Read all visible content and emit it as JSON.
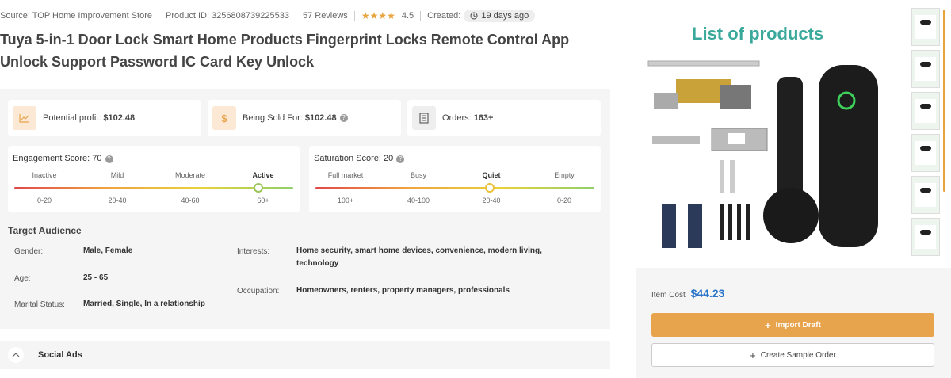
{
  "meta": {
    "source": "Source: TOP Home Improvement Store",
    "product_id": "Product ID: 3256808739225533",
    "reviews": "57 Reviews",
    "stars": "★★★★",
    "rating": "4.5",
    "created_label": "Created:",
    "created_value": "19 days ago"
  },
  "title": "Tuya 5-in-1 Door Lock Smart Home Products Fingerprint Locks Remote Control App Unlock Support Password IC Card Key Unlock",
  "stats": {
    "profit_label": "Potential profit:",
    "profit_value": "$102.48",
    "sold_label": "Being Sold For:",
    "sold_value": "$102.48",
    "orders_label": "Orders:",
    "orders_value": "163+"
  },
  "engagement": {
    "title": "Engagement Score: 70",
    "labels": [
      "Inactive",
      "Mild",
      "Moderate",
      "Active"
    ],
    "ranges": [
      "0-20",
      "20-40",
      "40-60",
      "60+"
    ],
    "level": 0.875
  },
  "saturation": {
    "title": "Saturation Score: 20",
    "labels": [
      "Full market",
      "Busy",
      "Quiet",
      "Empty"
    ],
    "ranges": [
      "100+",
      "40-100",
      "20-40",
      "0-20"
    ],
    "level": 0.625
  },
  "audience": {
    "title": "Target Audience",
    "gender_label": "Gender:",
    "gender": "Male, Female",
    "age_label": "Age:",
    "age": "25 - 65",
    "marital_label": "Marital Status:",
    "marital": "Married, Single, In a relationship",
    "interests_label": "Interests:",
    "interests": "Home security, smart home devices, convenience, modern living, technology",
    "occupation_label": "Occupation:",
    "occupation": "Homeowners, renters, property managers, professionals"
  },
  "social_ads": "Social Ads",
  "right": {
    "heading": "List of products",
    "cost_label": "Item Cost",
    "cost_value": "$44.23",
    "import_label": "Import Draft",
    "sample_label": "Create Sample Order"
  },
  "colors": {
    "accent": "#e8a44c",
    "price_blue": "#2b76c8",
    "heading_teal": "#3aa99b"
  }
}
